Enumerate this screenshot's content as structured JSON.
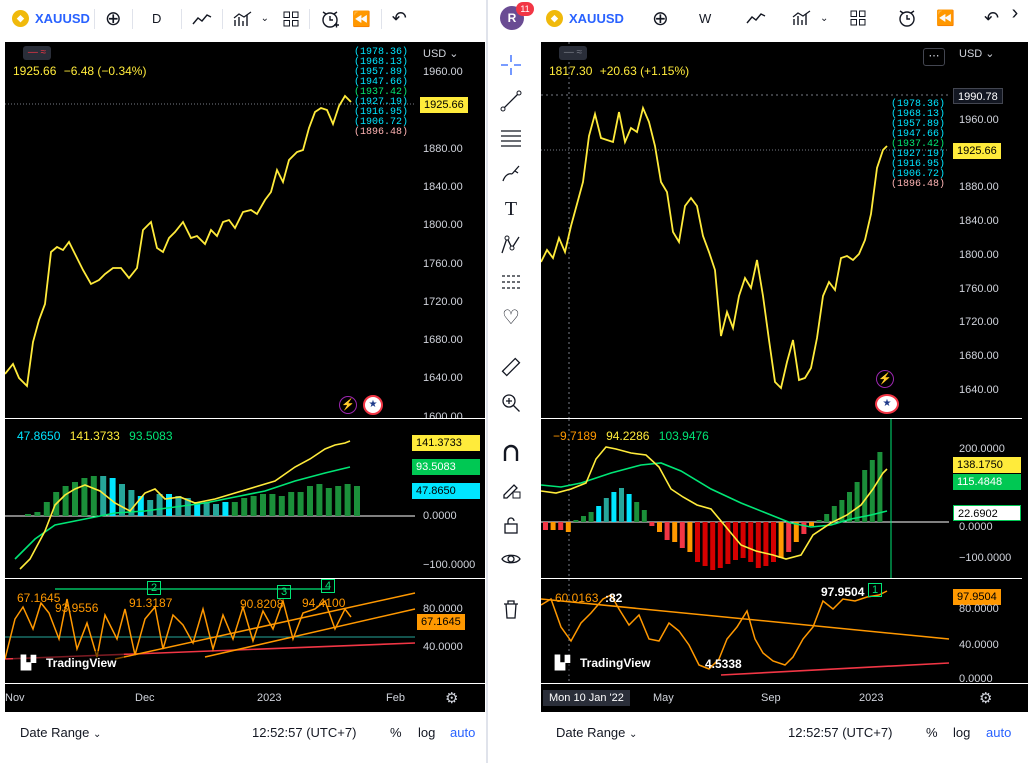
{
  "left": {
    "symbol": "XAUUSD",
    "interval": "D",
    "legend": {
      "price": "1925.66",
      "change": "−6.48 (−0.34%)"
    },
    "currency": "USD",
    "price_ticks": [
      "1960.00",
      "1920.00",
      "1880.00",
      "1840.00",
      "1800.00",
      "1760.00",
      "1720.00",
      "1680.00",
      "1640.00",
      "1600.00"
    ],
    "last_price": "1925.66",
    "levels": [
      "(1978.36)",
      "(1968.13)",
      "(1957.89)",
      "(1947.66)",
      "(1937.42)",
      "(1927.19)",
      "(1916.95)",
      "(1906.72)",
      "(1896.48)"
    ],
    "macd_legend": [
      "47.8650",
      "141.3733",
      "93.5083"
    ],
    "macd_tags": [
      "141.3733",
      "93.5083",
      "47.8650"
    ],
    "macd_ticks": [
      "0.0000",
      "−100.0000"
    ],
    "osc_ticks": [
      "80.0000",
      "40.0000"
    ],
    "osc_value": "67.1645",
    "osc_tag": "67.1645",
    "osc_labels": [
      "93.9556",
      "91.3187",
      "90.8208",
      "94.4100"
    ],
    "wave_labels": [
      "2",
      "3",
      "4"
    ],
    "x_labels": [
      "Nov",
      "Dec",
      "2023",
      "Feb"
    ],
    "watermark": "TradingView",
    "date_range": "Date Range",
    "time": "12:52:57 (UTC+7)",
    "pct": "%",
    "log": "log",
    "auto": "auto",
    "colors": {
      "price": "#ffeb3b",
      "up": "#26a69a",
      "green": "#00c853",
      "orange": "#ff9800",
      "red": "#f23645"
    }
  },
  "right": {
    "symbol": "XAUUSD",
    "interval": "W",
    "badge": "11",
    "avatar": "R",
    "legend": {
      "price": "1817.30",
      "change": "+20.63 (+1.15%)"
    },
    "currency": "USD",
    "price_ticks": [
      "1960.00",
      "1920.00",
      "1880.00",
      "1840.00",
      "1800.00",
      "1760.00",
      "1720.00",
      "1680.00",
      "1640.00"
    ],
    "crosshair_price": "1990.78",
    "last_price": "1925.66",
    "levels": [
      "(1978.36)",
      "(1968.13)",
      "(1957.89)",
      "(1947.66)",
      "(1937.42)",
      "(1927.19)",
      "(1916.95)",
      "(1906.72)",
      "(1896.48)"
    ],
    "macd_legend": [
      "−9.7189",
      "94.2286",
      "103.9476"
    ],
    "macd_tags": [
      "138.1750",
      "115.4848",
      "22.6902"
    ],
    "macd_ticks": [
      "200.0000",
      "0.0000",
      "−100.0000"
    ],
    "osc_ticks": [
      "80.0000",
      "40.0000",
      "0.0000"
    ],
    "osc_value": "60.0163",
    "osc_tag": "97.9504",
    "osc_labels": [
      "97.9504",
      "4.5338",
      ":82"
    ],
    "wave_label": "1",
    "x_labels": [
      "May",
      "Sep",
      "2023"
    ],
    "date_tag": "Mon 10 Jan '22",
    "watermark": "TradingView",
    "date_range": "Date Range",
    "time": "12:52:57 (UTC+7)",
    "pct": "%",
    "log": "log",
    "auto": "auto"
  }
}
